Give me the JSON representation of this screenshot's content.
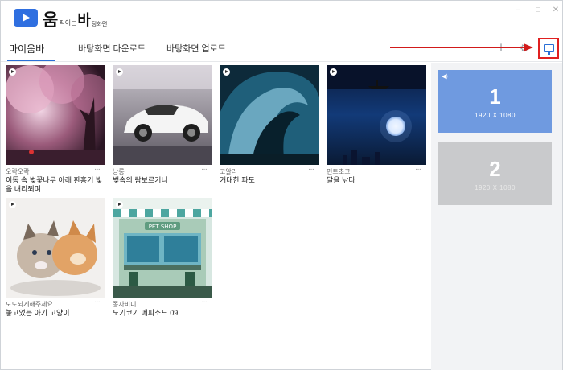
{
  "app": {
    "brand_main1": "움",
    "brand_sub1": "직이는",
    "brand_main2": "바",
    "brand_sub2": "탕화면",
    "window_controls": [
      "–",
      "□",
      "✕"
    ]
  },
  "tabs": [
    {
      "label": "마이움바",
      "active": true
    },
    {
      "label": "바탕화면 다운로드",
      "active": false
    },
    {
      "label": "바탕화면 업로드",
      "active": false
    }
  ],
  "toolbar": {
    "add_icon": "plus-icon",
    "settings_icon": "gear-icon",
    "monitor_icon": "monitor-icon",
    "add_glyph": "+",
    "settings_glyph": "⚙"
  },
  "colors": {
    "accent": "#2a6fd6",
    "highlight": "#e02020",
    "monitor_active": "#6f9ae0",
    "monitor_inactive": "#c9cacc"
  },
  "wallpapers": [
    {
      "author": "오락오락",
      "title": "이동 속 벚꽃나무 아래 환흥기 빛을 내리쬐며",
      "more": "···"
    },
    {
      "author": "낭롱",
      "title": "벚속의 람보르기니",
      "more": "···"
    },
    {
      "author": "코알라",
      "title": "거대한 파도",
      "more": "···"
    },
    {
      "author": "민트초코",
      "title": "달을 낚다",
      "more": "···"
    },
    {
      "author": "도도되게해주세요",
      "title": "놓고었는 아기 고양이",
      "more": "···"
    },
    {
      "author": "퐁자비니",
      "title": "도기코기 메피소드 09",
      "more": "···"
    }
  ],
  "monitors": [
    {
      "number": "1",
      "resolution": "1920 X 1080",
      "speaker_icon": "speaker-icon",
      "speaker_glyph": "◀)"
    },
    {
      "number": "2",
      "resolution": "1920 X 1080"
    }
  ]
}
